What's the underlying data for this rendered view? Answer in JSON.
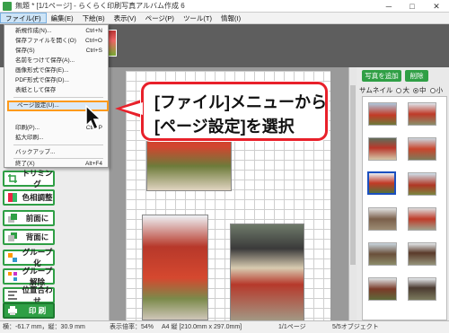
{
  "window": {
    "title": "無題 * [1/1ページ] - らくらく印刷写真アルバム作成 6",
    "minimize": "─",
    "maximize": "□",
    "close": "✕"
  },
  "menubar": {
    "items": [
      {
        "label": "ファイル(F)",
        "active": true
      },
      {
        "label": "編集(E)"
      },
      {
        "label": "下絵(B)"
      },
      {
        "label": "表示(V)"
      },
      {
        "label": "ページ(P)"
      },
      {
        "label": "ツール(T)"
      },
      {
        "label": "情報(I)"
      }
    ]
  },
  "file_menu": {
    "items": [
      {
        "label": "新規作成(N)...",
        "shortcut": "Ctrl+N"
      },
      {
        "label": "保存ファイルを開く(O)",
        "shortcut": "Ctrl+O"
      },
      {
        "label": "保存(S)",
        "shortcut": "Ctrl+S"
      },
      {
        "label": "名前をつけて保存(A)..."
      },
      {
        "label": "画像形式で保存(E)..."
      },
      {
        "label": "PDF形式で保存(D)..."
      },
      {
        "label": "表紙として保存"
      },
      {
        "label": "ページ設定(U)...",
        "highlighted": true
      },
      {
        "label": "印刷(P)...",
        "shortcut": "Ctrl+P"
      },
      {
        "label": "拡大印刷..."
      },
      {
        "label": "バックアップ..."
      },
      {
        "label": "終了(X)",
        "shortcut": "Alt+F4"
      }
    ]
  },
  "left_panel": {
    "buttons": [
      {
        "label": "トリミング",
        "icon": "crop-icon"
      },
      {
        "label": "色相調整",
        "icon": "color-icon"
      },
      {
        "label": "前面に",
        "icon": "bring-front-icon"
      },
      {
        "label": "背面に",
        "icon": "send-back-icon"
      },
      {
        "label": "グループ化",
        "icon": "group-icon"
      },
      {
        "label": "グループ解除",
        "icon": "ungroup-icon"
      },
      {
        "label": "位置合わせ",
        "icon": "align-icon"
      },
      {
        "label": "印 刷",
        "icon": "printer-icon"
      }
    ]
  },
  "right_panel": {
    "add_photo": "写真を追加",
    "delete": "削除",
    "thumbnail_label": "サムネイル",
    "size_options": [
      {
        "label": "大",
        "selected": false
      },
      {
        "label": "中",
        "selected": true
      },
      {
        "label": "小",
        "selected": false
      }
    ]
  },
  "callout": {
    "line1": "[ファイル]メニューから",
    "line2": "[ページ設定]を選択"
  },
  "statusbar": {
    "position": "横：-61.7 mm，縦：30.9 mm",
    "zoom": "表示倍率：54%",
    "paper": "A4 縦 [210.0mm x 297.0mm]",
    "page": "1/1ページ",
    "objects": "5/5オブジェクト"
  },
  "colors": {
    "accent_green": "#2f9f45",
    "callout_red": "#e8202a",
    "highlight_orange": "#ff9a1a"
  }
}
